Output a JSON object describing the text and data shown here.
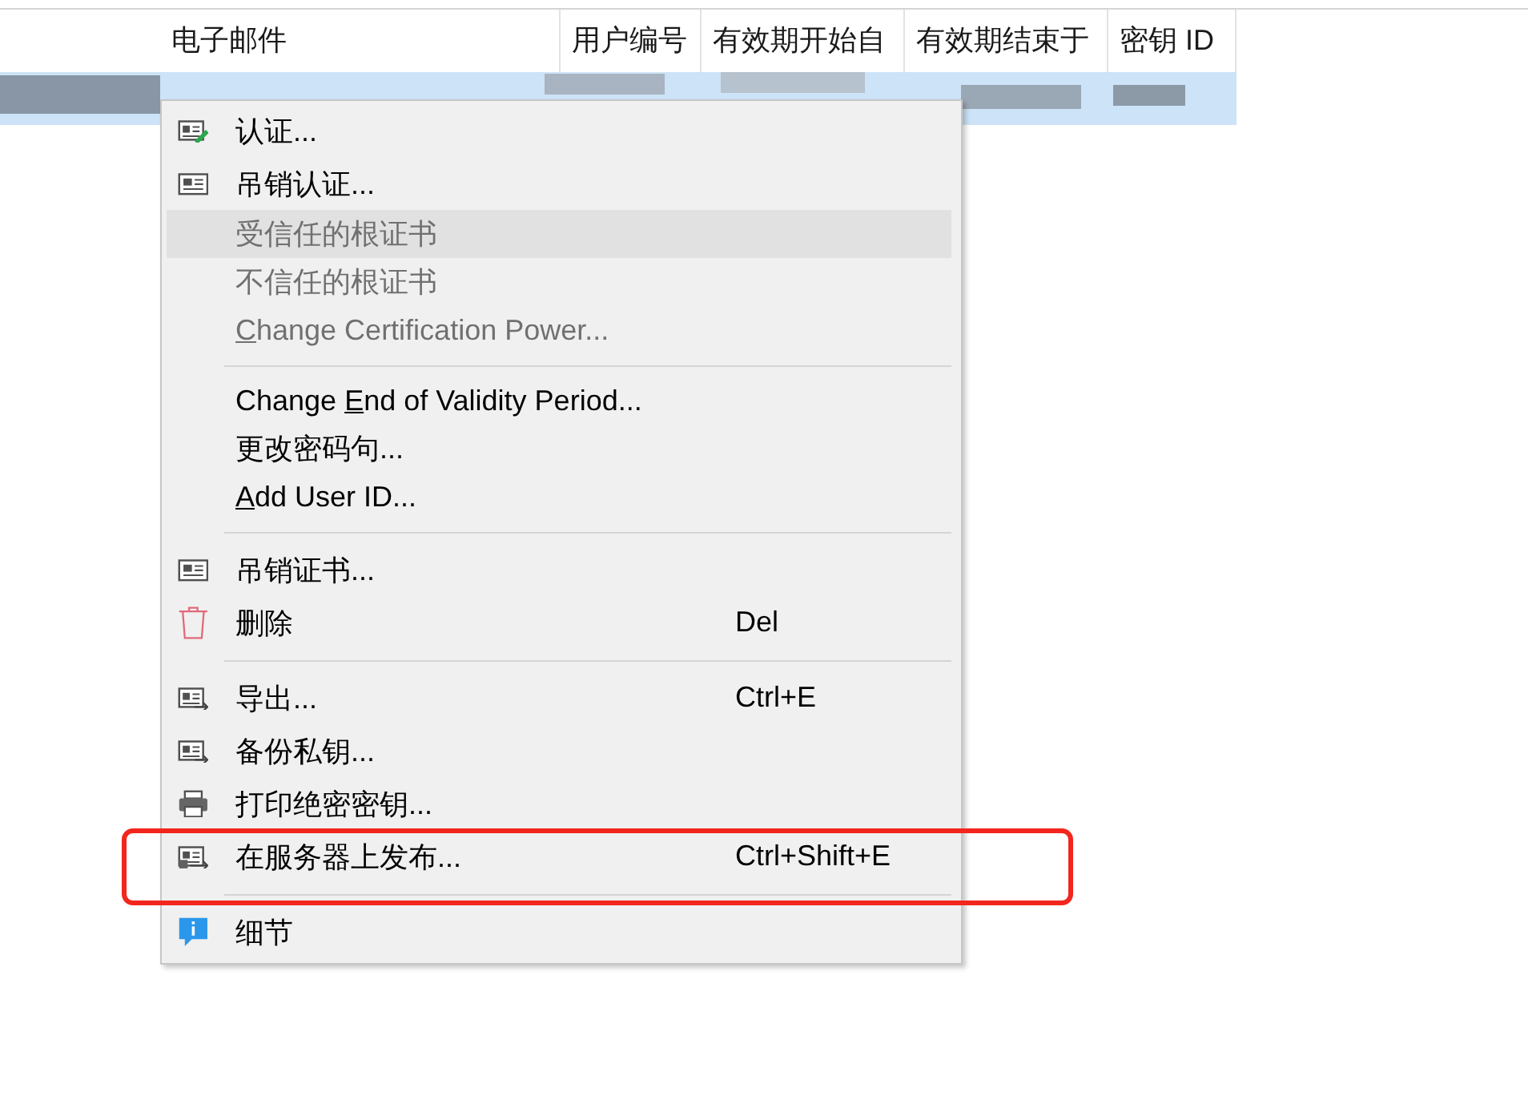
{
  "table": {
    "columns": [
      {
        "label": "电子邮件"
      },
      {
        "label": "用户编号"
      },
      {
        "label": "有效期开始自"
      },
      {
        "label": "有效期结束于"
      },
      {
        "label": "密钥 ID"
      }
    ],
    "rows": [
      {
        "selected": true
      }
    ]
  },
  "context_menu": {
    "items": [
      {
        "kind": "pen",
        "label": "认证...",
        "disabled": false,
        "hovered": false,
        "annotated": false
      },
      {
        "kind": "card",
        "label": "吊销认证...",
        "disabled": false,
        "hovered": false,
        "annotated": false
      },
      {
        "kind": "text",
        "label": "受信任的根证书",
        "disabled": true,
        "hovered": true,
        "annotated": false
      },
      {
        "kind": "text",
        "label": "不信任的根证书",
        "disabled": true,
        "hovered": false,
        "annotated": false
      },
      {
        "kind": "text",
        "access_key": "C",
        "label_rest": "hange Certification Power...",
        "disabled": true,
        "hovered": false,
        "annotated": false
      },
      {
        "kind": "separator"
      },
      {
        "kind": "text",
        "label_start": "Change ",
        "access_key": "E",
        "label_rest": "nd of Validity Period...",
        "disabled": false,
        "hovered": false,
        "annotated": false
      },
      {
        "kind": "text",
        "label": "更改密码句...",
        "disabled": false,
        "hovered": false,
        "annotated": false
      },
      {
        "kind": "text",
        "access_key": "A",
        "label_rest": "dd User ID...",
        "disabled": false,
        "hovered": false,
        "annotated": false
      },
      {
        "kind": "separator"
      },
      {
        "kind": "card",
        "label": "吊销证书...",
        "disabled": false,
        "hovered": false,
        "annotated": false
      },
      {
        "kind": "trash",
        "label": "删除",
        "shortcut": "Del",
        "disabled": false,
        "hovered": false,
        "annotated": false
      },
      {
        "kind": "separator"
      },
      {
        "kind": "export",
        "label": "导出...",
        "shortcut": "Ctrl+E",
        "disabled": false,
        "hovered": false,
        "annotated": false
      },
      {
        "kind": "export",
        "label": "备份私钥...",
        "disabled": false,
        "hovered": false,
        "annotated": false
      },
      {
        "kind": "printer",
        "label": "打印绝密密钥...",
        "disabled": false,
        "hovered": false,
        "annotated": false
      },
      {
        "kind": "server",
        "label": "在服务器上发布...",
        "shortcut": "Ctrl+Shift+E",
        "disabled": false,
        "hovered": false,
        "annotated": true
      },
      {
        "kind": "separator"
      },
      {
        "kind": "info",
        "label": "细节",
        "disabled": false,
        "hovered": false,
        "annotated": false
      }
    ]
  }
}
